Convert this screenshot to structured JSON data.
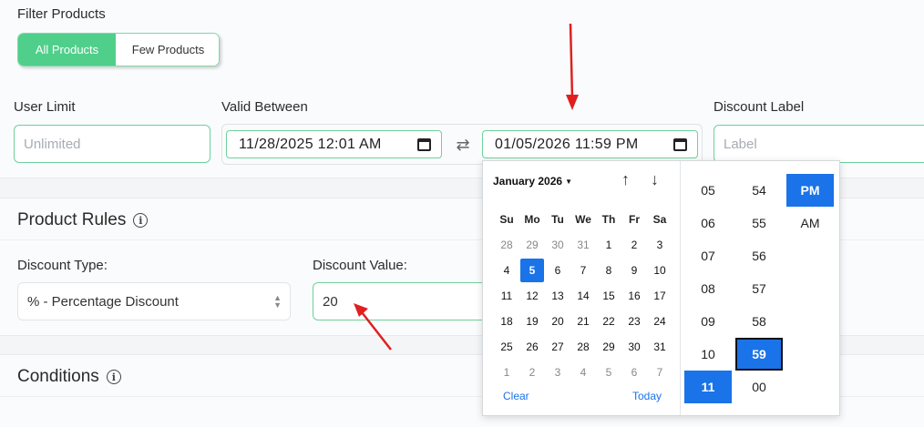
{
  "filter": {
    "title": "Filter Products",
    "options": [
      "All Products",
      "Few Products"
    ],
    "selected": "All Products"
  },
  "fields": {
    "user_limit": {
      "label": "User Limit",
      "placeholder": "Unlimited"
    },
    "valid_between": {
      "label": "Valid Between",
      "start": "11/28/2025 12:01 AM",
      "end": "01/05/2026 11:59 PM",
      "swap_icon": "swap-arrows-icon"
    },
    "discount_label": {
      "label": "Discount Label",
      "placeholder": "Label"
    }
  },
  "product_rules": {
    "title": "Product Rules",
    "discount_type": {
      "label": "Discount Type:",
      "value": "% - Percentage Discount"
    },
    "discount_value": {
      "label": "Discount Value:",
      "value": "20"
    }
  },
  "conditions": {
    "title": "Conditions"
  },
  "date_picker": {
    "month_label": "January 2026",
    "weekdays": [
      "Su",
      "Mo",
      "Tu",
      "We",
      "Th",
      "Fr",
      "Sa"
    ],
    "weeks": [
      [
        "28",
        "29",
        "30",
        "31",
        "1",
        "2",
        "3"
      ],
      [
        "4",
        "5",
        "6",
        "7",
        "8",
        "9",
        "10"
      ],
      [
        "11",
        "12",
        "13",
        "14",
        "15",
        "16",
        "17"
      ],
      [
        "18",
        "19",
        "20",
        "21",
        "22",
        "23",
        "24"
      ],
      [
        "25",
        "26",
        "27",
        "28",
        "29",
        "30",
        "31"
      ],
      [
        "1",
        "2",
        "3",
        "4",
        "5",
        "6",
        "7"
      ]
    ],
    "selected_day": "5",
    "clear_label": "Clear",
    "today_label": "Today",
    "hours": [
      "05",
      "06",
      "07",
      "08",
      "09",
      "10",
      "11"
    ],
    "selected_hour": "11",
    "minutes": [
      "54",
      "55",
      "56",
      "57",
      "58",
      "59",
      "00"
    ],
    "selected_minute": "59",
    "periods": [
      "PM",
      "AM"
    ],
    "selected_period": "PM"
  },
  "colors": {
    "accent_green": "#4fcf8a",
    "picker_blue": "#1a73e8",
    "annotation_red": "#e02020"
  }
}
